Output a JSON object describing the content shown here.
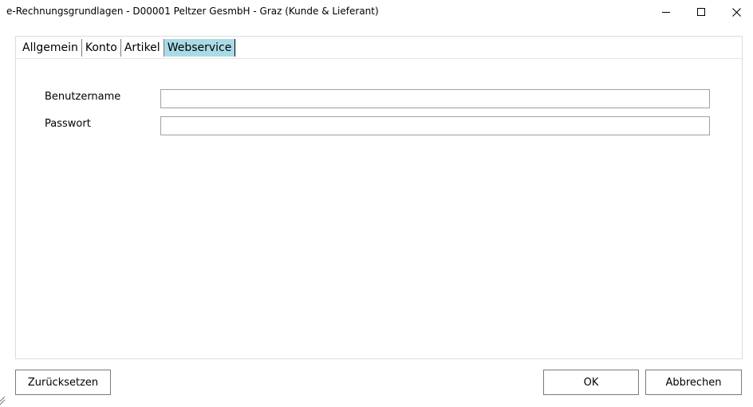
{
  "window": {
    "title": "e-Rechnungsgrundlagen - D00001 Peltzer GesmbH - Graz (Kunde & Lieferant)",
    "controls": {
      "minimize_icon": "minimize-icon",
      "maximize_icon": "maximize-icon",
      "close_icon": "close-icon"
    }
  },
  "tabs": [
    {
      "label": "Allgemein",
      "active": false
    },
    {
      "label": "Konto",
      "active": false
    },
    {
      "label": "Artikel",
      "active": false
    },
    {
      "label": "Webservice",
      "active": true
    }
  ],
  "form": {
    "username": {
      "label": "Benutzername",
      "value": "",
      "placeholder": ""
    },
    "password": {
      "label": "Passwort",
      "value": "",
      "placeholder": ""
    }
  },
  "buttons": {
    "reset": "Zurücksetzen",
    "ok": "OK",
    "cancel": "Abbrechen"
  },
  "colors": {
    "active_tab": "#a9dbe6",
    "border": "#7a7a7a"
  }
}
